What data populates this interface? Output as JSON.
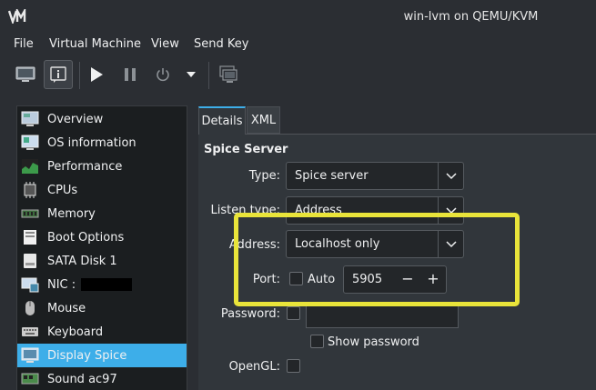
{
  "window": {
    "title": "win-lvm on QEMU/KVM",
    "logo_icon": "virt-manager-logo"
  },
  "menubar": {
    "items": [
      "File",
      "Virtual Machine",
      "View",
      "Send Key"
    ]
  },
  "toolbar": {
    "buttons": [
      {
        "icon": "console-icon"
      },
      {
        "icon": "details-icon",
        "pressed": true
      },
      {
        "icon": "run-icon"
      },
      {
        "icon": "pause-icon"
      },
      {
        "icon": "power-icon"
      },
      {
        "icon": "dropdown-arrow-icon"
      },
      {
        "icon": "fullscreen-icon"
      }
    ]
  },
  "sidebar": {
    "items": [
      {
        "label": "Overview",
        "icon": "overview-icon"
      },
      {
        "label": "OS information",
        "icon": "os-info-icon"
      },
      {
        "label": "Performance",
        "icon": "performance-icon"
      },
      {
        "label": "CPUs",
        "icon": "cpu-icon"
      },
      {
        "label": "Memory",
        "icon": "memory-icon"
      },
      {
        "label": "Boot Options",
        "icon": "boot-icon"
      },
      {
        "label": "SATA Disk 1",
        "icon": "disk-icon"
      },
      {
        "label": "NIC :",
        "icon": "nic-icon",
        "redacted": true
      },
      {
        "label": "Mouse",
        "icon": "mouse-icon"
      },
      {
        "label": "Keyboard",
        "icon": "keyboard-icon"
      },
      {
        "label": "Display Spice",
        "icon": "display-icon",
        "selected": true
      },
      {
        "label": "Sound ac97",
        "icon": "sound-icon"
      }
    ]
  },
  "tabs": [
    {
      "label": "Details",
      "active": true
    },
    {
      "label": "XML",
      "active": false
    }
  ],
  "form": {
    "section_title": "Spice Server",
    "type_label": "Type:",
    "type_value": "Spice server",
    "listen_label": "Listen type:",
    "listen_value": "Address",
    "address_label": "Address:",
    "address_value": "Localhost only",
    "port_label": "Port:",
    "auto_label": "Auto",
    "port_value": "5905",
    "minus": "−",
    "plus": "+",
    "password_label": "Password:",
    "show_password_label": "Show password",
    "opengl_label": "OpenGL:"
  },
  "colors": {
    "accent": "#3daee9",
    "highlight": "#e9e43a",
    "background": "#2b2e33"
  }
}
